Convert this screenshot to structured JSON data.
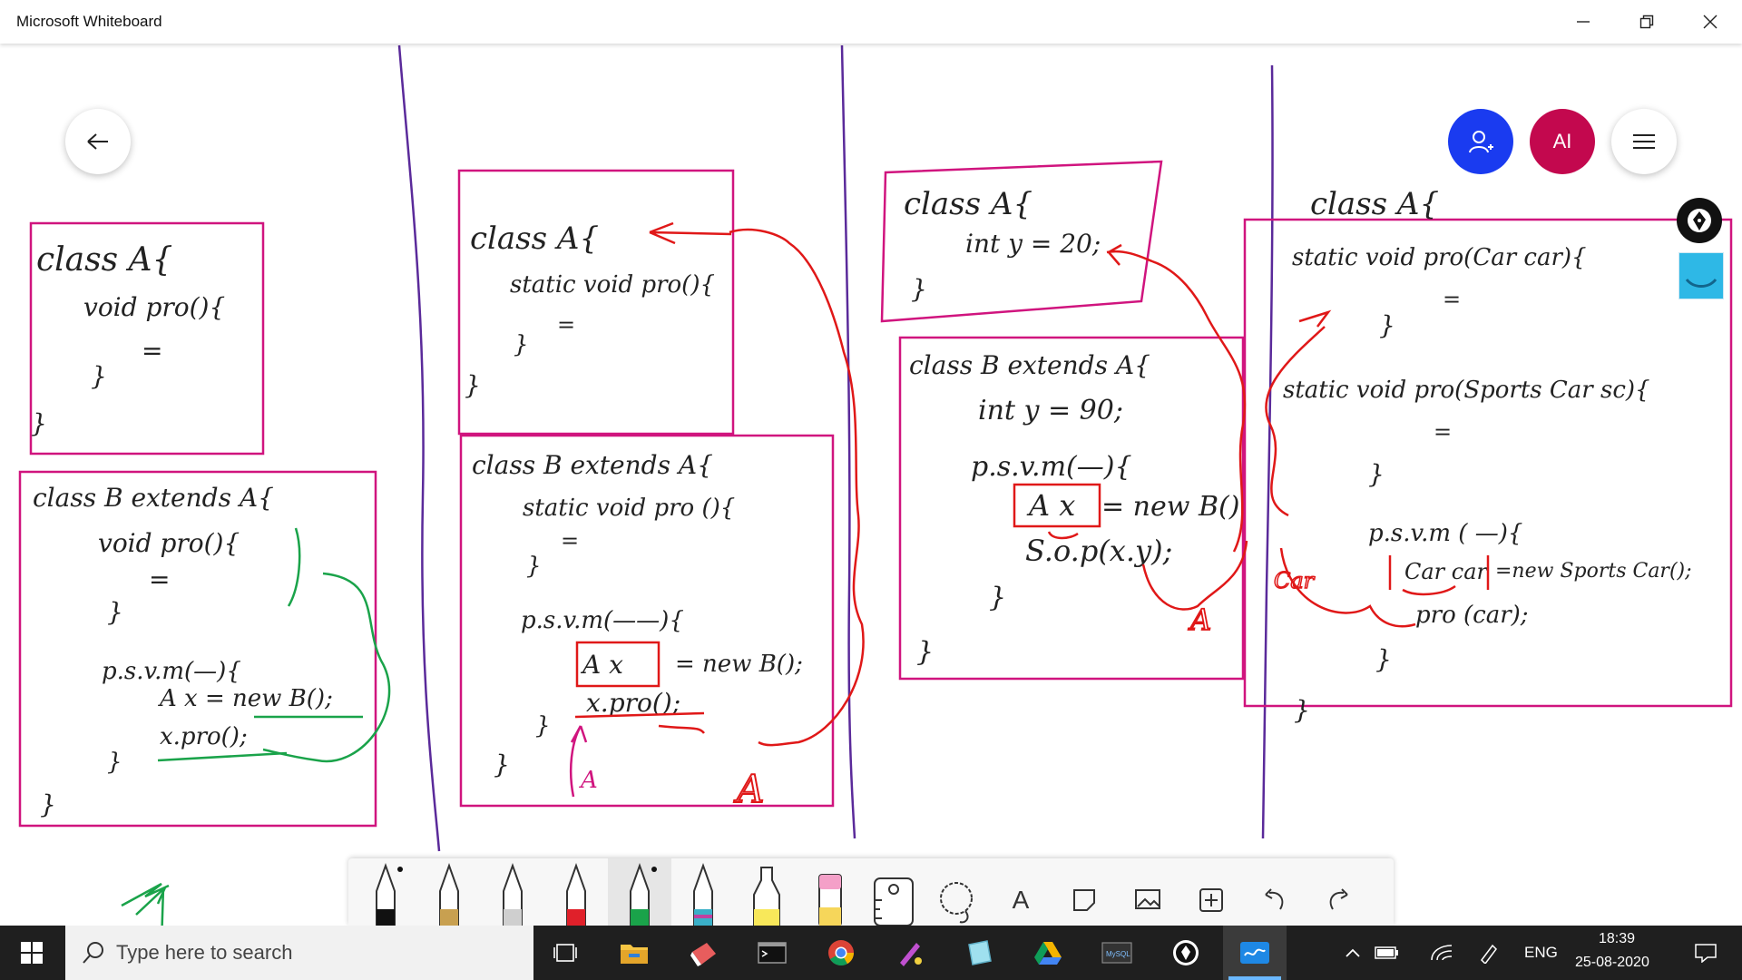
{
  "window": {
    "title": "Microsoft Whiteboard",
    "controls": [
      "minimize",
      "restore",
      "close"
    ]
  },
  "header_buttons": {
    "back": "arrow-left-icon",
    "invite": "add-person-icon",
    "avatar_initials": "AI",
    "menu": "hamburger-icon"
  },
  "board": {
    "panel1": {
      "classA": [
        "class  A{",
        "void  pro(){",
        "=",
        "}",
        "}"
      ],
      "classB": [
        "class    B extends A{",
        "void  pro(){",
        "=",
        "}",
        "p.s.v.m(—){",
        "A  x  =  new  B();",
        "x.pro();",
        "}",
        "}"
      ]
    },
    "panel2": {
      "classA": [
        "class  A{",
        "static void pro(){",
        "=",
        "}",
        "}"
      ],
      "classB": [
        "class B extends A{",
        "static void  pro (){",
        "=",
        "}",
        "p.s.v.m(——){",
        "A  x",
        "=  new  B();",
        "x.pro();",
        "}",
        "}"
      ],
      "annotations": [
        "A",
        "A"
      ]
    },
    "panel3": {
      "classA": [
        "class  A{",
        "int  y = 20;",
        "}"
      ],
      "classB": [
        "class  B  extends  A{",
        "int  y = 90;",
        "p.s.v.m(—){",
        "A  x",
        "=  new  B()",
        "S.o.p(x.y);",
        "}",
        "}"
      ],
      "annotations": [
        "A"
      ]
    },
    "panel4": {
      "header": "class  A{",
      "lines": [
        "static  void  pro(Car car){",
        "=",
        "}",
        "static  void  pro(Sports Car sc){",
        "=",
        "}",
        "p.s.v.m ( —){",
        "Car  car",
        "=new  Sports Car();",
        "pro (car);",
        "}",
        "}"
      ],
      "annotations": [
        "Car"
      ]
    }
  },
  "side_tools": [
    "pen-nib-icon",
    "ruler-tool-icon"
  ],
  "toolbar": {
    "tools": [
      {
        "name": "pen-black",
        "color": "#111111"
      },
      {
        "name": "pen-gold",
        "color": "#c8a050"
      },
      {
        "name": "pen-silver",
        "color": "#d0d0d0"
      },
      {
        "name": "pen-red",
        "color": "#e0202a"
      },
      {
        "name": "pen-green",
        "color": "#1aa34a"
      },
      {
        "name": "pen-galaxy",
        "color": "#3ab0c8"
      },
      {
        "name": "highlighter-yellow",
        "color": "#f8e85a"
      },
      {
        "name": "eraser",
        "color": "#f4a0c8"
      },
      {
        "name": "ruler",
        "color": "#333333"
      },
      {
        "name": "lasso",
        "color": "#333333"
      },
      {
        "name": "text",
        "color": "#333333"
      },
      {
        "name": "note",
        "color": "#333333"
      },
      {
        "name": "image",
        "color": "#333333"
      },
      {
        "name": "add",
        "color": "#333333"
      },
      {
        "name": "undo",
        "color": "#333333"
      },
      {
        "name": "redo",
        "color": "#333333"
      }
    ],
    "text_tool_label": "A"
  },
  "taskbar": {
    "search_placeholder": "Type here to search",
    "apps": [
      "task-view-icon",
      "file-explorer-icon",
      "paint-icon",
      "terminal-icon",
      "chrome-icon",
      "sketch-icon",
      "notes-icon",
      "google-drive-icon",
      "mysql-icon",
      "pen-app-icon",
      "whiteboard-icon"
    ],
    "language": "ENG",
    "time": "18:39",
    "date": "25-08-2020"
  },
  "colors": {
    "box_magenta": "#d0147e",
    "annotation_red": "#e01818",
    "annotation_green": "#1aa34a",
    "divider_purple": "#5a2a9a",
    "taskbar_bg": "#1f1f1f",
    "invite_blue": "#1a3bf0",
    "avatar_red": "#c3084e"
  }
}
